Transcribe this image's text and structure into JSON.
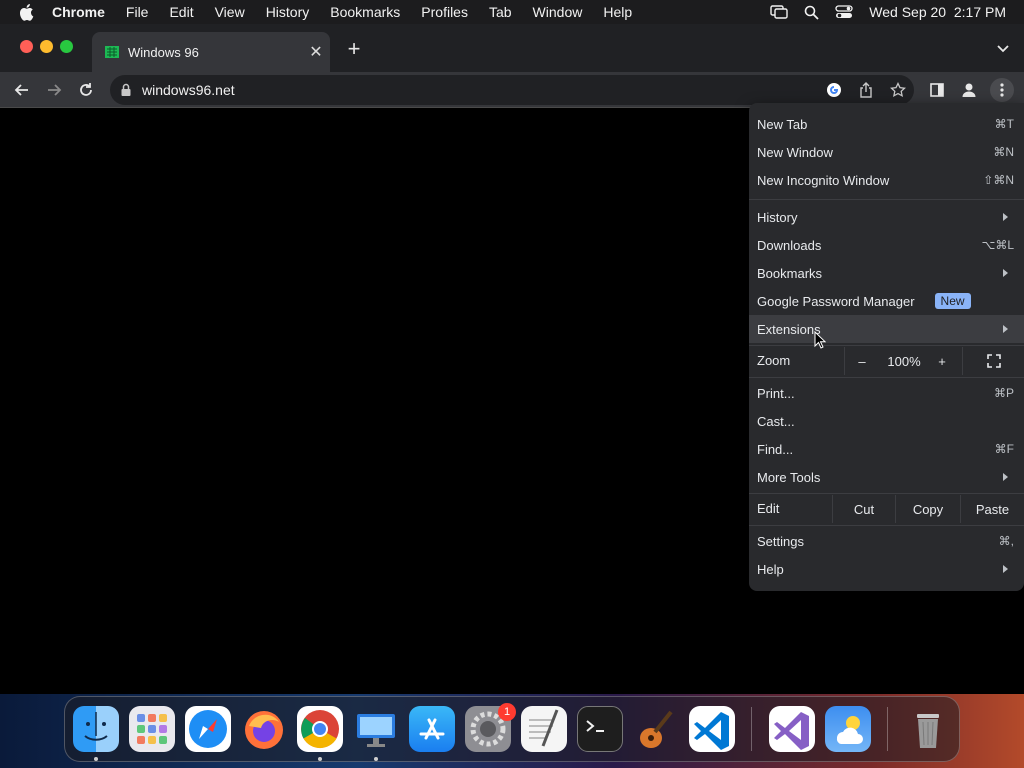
{
  "menubar": {
    "items": [
      "Chrome",
      "File",
      "Edit",
      "View",
      "History",
      "Bookmarks",
      "Profiles",
      "Tab",
      "Window",
      "Help"
    ],
    "datetime": "Wed Sep 20  2:17 PM"
  },
  "tab": {
    "title": "Windows 96",
    "close": "✕",
    "new_tab": "+"
  },
  "omnibox": {
    "url": "windows96.net"
  },
  "menu": {
    "new_tab": {
      "label": "New Tab",
      "shortcut": "⌘T"
    },
    "new_window": {
      "label": "New Window",
      "shortcut": "⌘N"
    },
    "new_incognito": {
      "label": "New Incognito Window",
      "shortcut": "⇧⌘N"
    },
    "history": {
      "label": "History"
    },
    "downloads": {
      "label": "Downloads",
      "shortcut": "⌥⌘L"
    },
    "bookmarks": {
      "label": "Bookmarks"
    },
    "password_manager": {
      "label": "Google Password Manager",
      "badge": "New"
    },
    "extensions": {
      "label": "Extensions"
    },
    "zoom": {
      "label": "Zoom",
      "minus": "–",
      "value": "100%",
      "plus": "+"
    },
    "print": {
      "label": "Print...",
      "shortcut": "⌘P"
    },
    "cast": {
      "label": "Cast..."
    },
    "find": {
      "label": "Find...",
      "shortcut": "⌘F"
    },
    "more_tools": {
      "label": "More Tools"
    },
    "edit": {
      "label": "Edit",
      "cut": "Cut",
      "copy": "Copy",
      "paste": "Paste"
    },
    "settings": {
      "label": "Settings",
      "shortcut": "⌘,"
    },
    "help": {
      "label": "Help"
    }
  },
  "dock": {
    "apps": [
      "finder-icon",
      "launchpad-icon",
      "safari-icon",
      "firefox-icon",
      "chrome-icon",
      "remote-desktop-icon",
      "app-store-icon",
      "system-settings-icon",
      "textedit-icon",
      "terminal-icon",
      "garageband-icon",
      "vscode-icon",
      "visual-studio-icon",
      "weather-icon",
      "trash-icon"
    ],
    "settings_badge": "1"
  },
  "colors": {
    "menu_bg": "#292a2d",
    "badge_new": "#8ab4f8",
    "toolbar": "#35363a"
  }
}
